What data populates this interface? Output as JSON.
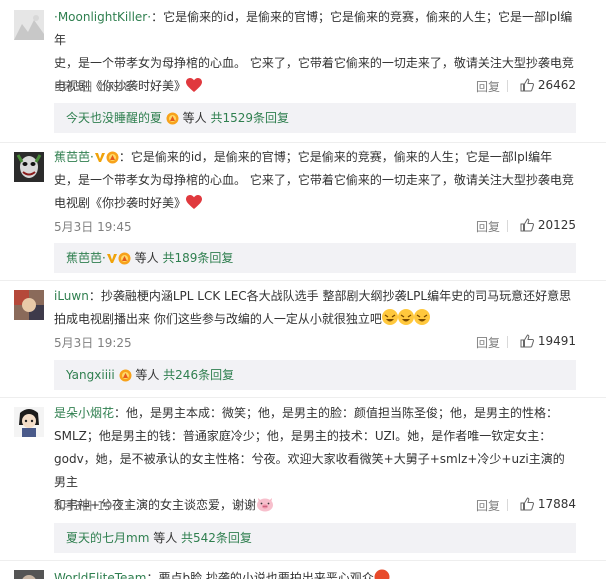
{
  "comments": [
    {
      "user": "·MoonlightKiller·",
      "lines": [
        "：它是偷来的id，是偷来的官博；它是偷来的竞赛，偷来的人生；它是一部lpl编年",
        "史，是一个带孝女为母挣棺的心血。 它来了，它带着它偷来的一切走来了，敬请关注大型抄袭电竞",
        "电视剧《你抄袭时好美》"
      ],
      "time": "5月3日 19:48",
      "reply": "回复",
      "likes": "26462",
      "sub_user": "今天也没睡醒的夏",
      "sub_tail": " 等人 ",
      "sub_count": "共1529条回复"
    },
    {
      "user": "蕉芭芭·",
      "lines": [
        "：它是偷来的id，是偷来的官博；它是偷来的竞赛，偷来的人生；它是一部lpl编年",
        "史，是一个带孝女为母挣棺的心血。 它来了，它带着它偷来的一切走来了，敬请关注大型抄袭电竞",
        "电视剧《你抄袭时好美》"
      ],
      "time": "5月3日 19:45",
      "reply": "回复",
      "likes": "20125",
      "sub_user": "蕉芭芭·",
      "sub_tail": " 等人 ",
      "sub_count": "共189条回复"
    },
    {
      "user": "iLuwn",
      "lines": [
        "：抄袭融梗内涵LPL LCK LEC各大战队选手 整部剧大纲抄袭LPL编年史的司马玩意还好意思",
        "拍成电视剧播出来 你们这些参与改编的人一定从小就很独立吧"
      ],
      "time": "5月3日 19:25",
      "reply": "回复",
      "likes": "19491",
      "sub_user": "Yangxiiii",
      "sub_tail": " 等人 ",
      "sub_count": "共246条回复"
    },
    {
      "user": "是朵小烟花",
      "lines": [
        "：他，是男主本成：微笑；他，是男主的脸：颜值担当陈圣俊；他，是男主的性格：",
        "SMLZ；他是男主的钱：普通家庭冷少；他，是男主的技术：UZI。她，是作者唯一钦定女主：",
        "godv，她，是不被承认的女主性格：兮夜。欢迎大家收看微笑+大舅子+smlz+冷少+uzi主演的男主",
        "和韦神+兮夜主演的女主谈恋爱，谢谢"
      ],
      "time": "5月3日 19:11",
      "reply": "回复",
      "likes": "17884",
      "sub_user": "夏天的七月mm",
      "sub_tail": " 等人 ",
      "sub_count": "共542条回复"
    },
    {
      "user": "WorldEliteTeam",
      "lines": [
        "：要点b脸 抄袭的小说也要拍出来恶心观众"
      ]
    }
  ],
  "colors": {
    "username": "#2f7f4f",
    "text": "#333333",
    "meta": "#808080",
    "subbox_bg": "#f2f2f5"
  },
  "icons": [
    "thumb-up-icon",
    "heart-icon",
    "verified-v-icon",
    "member-badge-icon",
    "laugh-emoji-icon",
    "pig-emoji-icon"
  ]
}
